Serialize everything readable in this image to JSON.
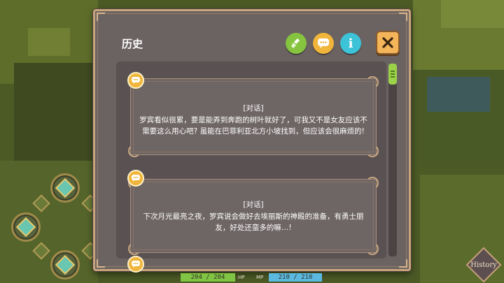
{
  "window": {
    "title": "历史",
    "buttons": {
      "clear_icon": "broom-icon",
      "chat_icon": "speech-bubble-icon",
      "info_label": "i",
      "close_icon": "close-icon"
    }
  },
  "log": {
    "entries": [
      {
        "tag": "[对话]",
        "text": "罗宾看似很累，要是能弄到奔跑的树叶就好了，可我又不是女友应该不需要这么用心吧? 虽能在巴菲利亚北方小坡找到，但应该会很麻烦的!"
      },
      {
        "tag": "[对话]",
        "text": "下次月光最亮之夜，罗宾说会做好去埃丽斯的神殿的准备，有勇士朋友，好处还蛮多的嘛…!"
      }
    ]
  },
  "hud": {
    "history_label": "History",
    "hp_value": "204 / 204",
    "hp_label": "HP",
    "mp_label": "MP",
    "mp_value": "210 / 210"
  },
  "colors": {
    "panel": "#6b6262",
    "border": "#c9a57e",
    "accent_yellow": "#f0b53a",
    "accent_green": "#86c440",
    "accent_cyan": "#3cc3d8",
    "close_orange": "#f3b45a"
  }
}
